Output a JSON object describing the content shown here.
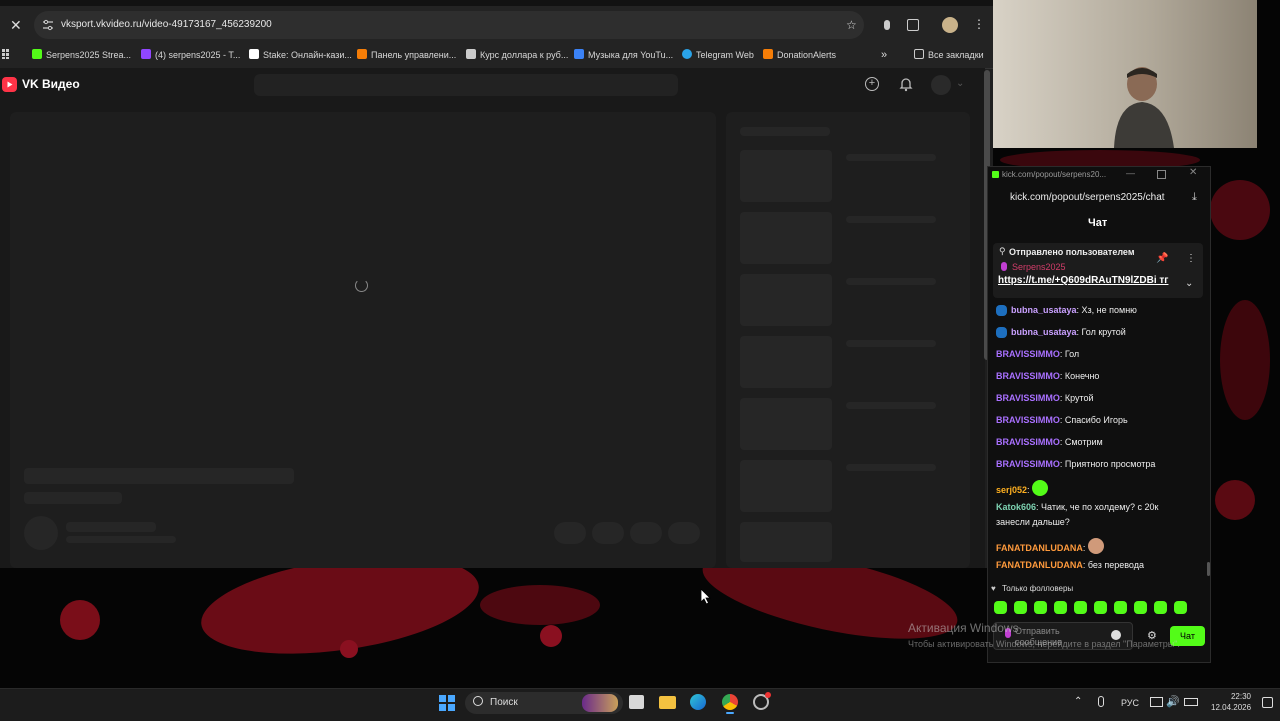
{
  "browser": {
    "url": "vksport.vkvideo.ru/video-49173167_456239200",
    "bookmarks": [
      {
        "label": "Serpens2025 Strea...",
        "color": "#53fc18"
      },
      {
        "label": "(4) serpens2025 - T...",
        "color": "#9146ff"
      },
      {
        "label": "Stake: Онлайн-кази...",
        "color": "#ffffff"
      },
      {
        "label": "Панель управлени...",
        "color": "#f57d07"
      },
      {
        "label": "Курс доллара к руб...",
        "color": "#cccccc"
      },
      {
        "label": "Музыка для YouTu...",
        "color": "#3b82f6"
      },
      {
        "label": "Telegram Web",
        "color": "#2aa3e8"
      },
      {
        "label": "DonationAlerts",
        "color": "#f57d07"
      }
    ],
    "more_bookmarks": "»",
    "all_bookmarks": "Все закладки"
  },
  "vk": {
    "logo": "VK Видео",
    "brand_color": "#ff3347"
  },
  "chat": {
    "window_url": "kick.com/popout/serpens20...",
    "url": "kick.com/popout/serpens2025/chat",
    "title": "Чат",
    "pinned": {
      "header": "Отправлено пользователем",
      "author": "Serpens2025",
      "link": "https://t.me/+Q609dRAuTN9lZDBi тг"
    },
    "messages": [
      {
        "user": "bubna_usataya",
        "text": ": Хз, не помню",
        "color": "#c9a0ff",
        "badge": true
      },
      {
        "user": "bubna_usataya",
        "text": ": Гол крутой",
        "color": "#c9a0ff",
        "badge": true
      },
      {
        "user": "BRAVISSIMMO",
        "text": ": Гол",
        "color": "#a970ff",
        "badge": false
      },
      {
        "user": "BRAVISSIMMO",
        "text": ": Конечно",
        "color": "#a970ff",
        "badge": false
      },
      {
        "user": "BRAVISSIMMO",
        "text": ": Крутой",
        "color": "#a970ff",
        "badge": false
      },
      {
        "user": "BRAVISSIMMO",
        "text": ": Спасибо Игорь",
        "color": "#a970ff",
        "badge": false
      },
      {
        "user": "BRAVISSIMMO",
        "text": ": Смотрим",
        "color": "#a970ff",
        "badge": false
      },
      {
        "user": "BRAVISSIMMO",
        "text": ": Приятного просмотра",
        "color": "#a970ff",
        "badge": false
      },
      {
        "user": "serj052",
        "text": ":",
        "color": "#ffb020",
        "badge": false
      },
      {
        "user": "Katok606",
        "text": ": Чатик, че по холдему? с 20к",
        "color": "#7ed3b2",
        "badge": false
      },
      {
        "user": "",
        "text": "занесли дальше?",
        "color": "#7ed3b2",
        "badge": false
      },
      {
        "user": "FANATDANLUDANA",
        "text": ":",
        "color": "#ff9a3c",
        "badge": false
      },
      {
        "user": "FANATDANLUDANA",
        "text": ": без перевода",
        "color": "#ff9a3c",
        "badge": false
      }
    ],
    "followers_only": "Только фолловеры",
    "input_placeholder": "Отправить сообщение",
    "send_label": "Чат",
    "accent": "#53fc18"
  },
  "watermark": {
    "title": "Активация Windows",
    "subtitle": "Чтобы активировать Windows, перейдите в раздел \"Параметры\"."
  },
  "taskbar": {
    "search": "Поиск",
    "language": "РУС",
    "time": "22:30",
    "date": "12.04.2026"
  }
}
